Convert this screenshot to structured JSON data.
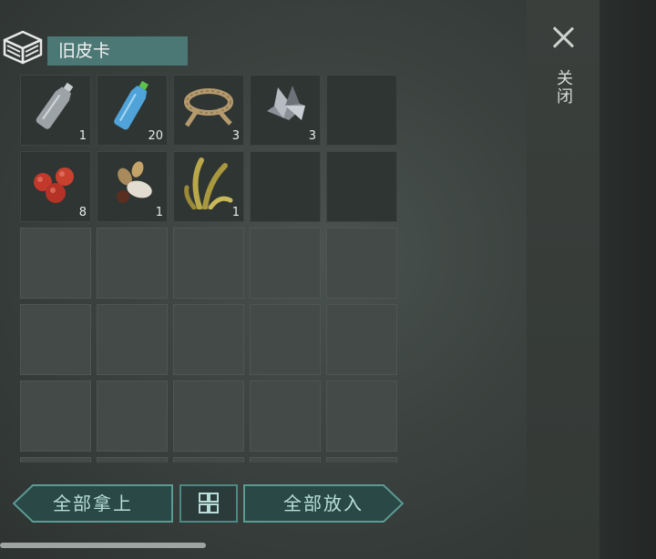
{
  "container": {
    "title": "旧皮卡",
    "icon": "crate-box-icon"
  },
  "close": {
    "label": "关闭",
    "icon": "close-x-icon"
  },
  "slots": [
    {
      "icon": "empty-plastic-bottle-icon",
      "count": "1"
    },
    {
      "icon": "water-bottle-icon",
      "count": "20"
    },
    {
      "icon": "rope-icon",
      "count": "3"
    },
    {
      "icon": "scrap-metal-icon",
      "count": "3"
    },
    {
      "icon": "",
      "count": ""
    },
    {
      "icon": "red-berries-icon",
      "count": "8"
    },
    {
      "icon": "seeds-icon",
      "count": "1"
    },
    {
      "icon": "plant-fiber-icon",
      "count": "1"
    }
  ],
  "buttons": {
    "take_all": "全部拿上",
    "put_all": "全部放入",
    "sort_icon": "sort-grid-icon"
  },
  "colors": {
    "accent": "#4e8a84",
    "title_bg": "#4b7775",
    "button_text": "#b9ded9"
  }
}
